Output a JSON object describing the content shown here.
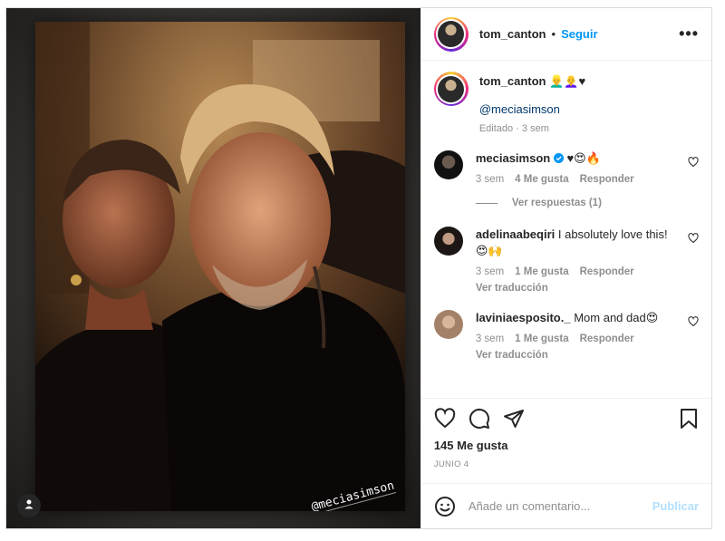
{
  "post": {
    "author": "tom_canton",
    "follow_label": "Seguir",
    "separator": "•",
    "more_label": "•••"
  },
  "caption": {
    "username": "tom_canton",
    "emojis": "👱‍♂️👩‍🦲♥",
    "mention": "@meciasimson",
    "meta": "Editado · 3 sem"
  },
  "photo": {
    "story_tag": "@meciasimson"
  },
  "comments": [
    {
      "username": "meciasimson",
      "verified": true,
      "text": "♥😍🔥",
      "time": "3 sem",
      "likes": "4 Me gusta",
      "reply": "Responder",
      "view_replies": "Ver respuestas (1)"
    },
    {
      "username": "adelinaabeqiri",
      "text": "I absolutely love this!",
      "text2": "😍🙌",
      "time": "3 sem",
      "likes": "1 Me gusta",
      "reply": "Responder",
      "translate": "Ver traducción"
    },
    {
      "username": "laviniaesposito._",
      "text": "Mom and dad😍",
      "time": "3 sem",
      "likes": "1 Me gusta",
      "reply": "Responder",
      "translate": "Ver traducción"
    }
  ],
  "engagement": {
    "likes": "145 Me gusta",
    "date": "JUNIO 4"
  },
  "composer": {
    "placeholder": "Añade un comentario...",
    "publish": "Publicar"
  },
  "colors": {
    "accent": "#0095f6",
    "publish_disabled": "#b2dffc",
    "secondary_text": "#8e8e8e",
    "border": "#dbdbdb"
  },
  "icons": [
    "more-options-icon",
    "heart-icon",
    "comment-icon",
    "share-icon",
    "bookmark-icon",
    "emoji-icon",
    "verified-icon",
    "user-tag-icon"
  ]
}
